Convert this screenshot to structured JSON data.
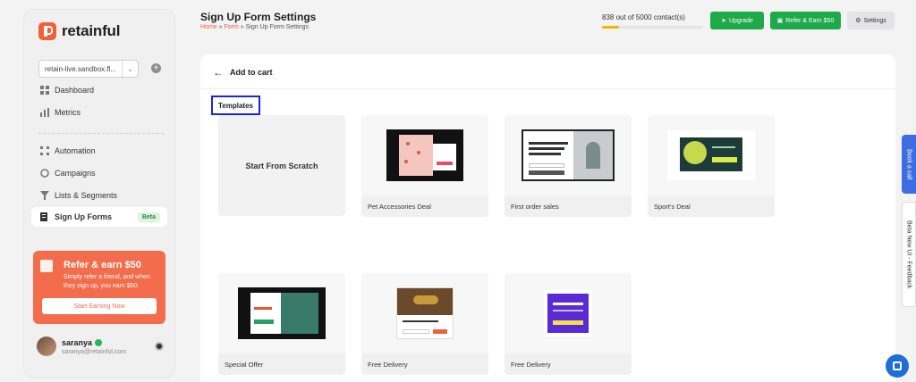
{
  "sidebar": {
    "logo_text": "retainful",
    "store_selector": "retain-live.sandbox.fl...",
    "nav": [
      {
        "label": "Dashboard",
        "icon": "dashboard-icon"
      },
      {
        "label": "Metrics",
        "icon": "metrics-icon"
      },
      {
        "label": "Automation",
        "icon": "automation-icon"
      },
      {
        "label": "Campaigns",
        "icon": "campaigns-icon"
      },
      {
        "label": "Lists & Segments",
        "icon": "lists-icon"
      },
      {
        "label": "Sign Up Forms",
        "icon": "signup-forms-icon",
        "badge": "Beta",
        "active": true
      }
    ],
    "referral": {
      "title": "Refer & earn $50",
      "description": "Simply refer a friend, and when they sign up, you earn $50.",
      "button": "Start Earning Now"
    },
    "user": {
      "name": "saranya",
      "email": "saranya@retainful.com"
    }
  },
  "header": {
    "title": "Sign Up Form Settings",
    "breadcrumb": [
      "Home",
      "Form",
      "Sign Up Form Settings"
    ],
    "contacts_text": "838 out of 5000 contact(s)",
    "contacts_used": 838,
    "contacts_total": 5000,
    "upgrade_label": "Upgrade",
    "refer_label": "Refer & Earn $50",
    "settings_label": "Settings"
  },
  "main": {
    "back_label": "Add to cart",
    "templates_label": "Templates",
    "scratch_label": "Start From Scratch",
    "templates": [
      {
        "name": "Pet Accessories Deal"
      },
      {
        "name": "First order sales"
      },
      {
        "name": "Sport's Deal"
      },
      {
        "name": "Special Offer"
      },
      {
        "name": "Free Delivery"
      },
      {
        "name": "Free Delivery"
      }
    ]
  },
  "side_tabs": {
    "book_call": "Book a call",
    "feedback": "Beta New UI - Feedback"
  },
  "colors": {
    "accent": "#f2603a",
    "green": "#1faa4a",
    "blue_highlight": "#1a24e0",
    "book_tab": "#3d6de0"
  }
}
